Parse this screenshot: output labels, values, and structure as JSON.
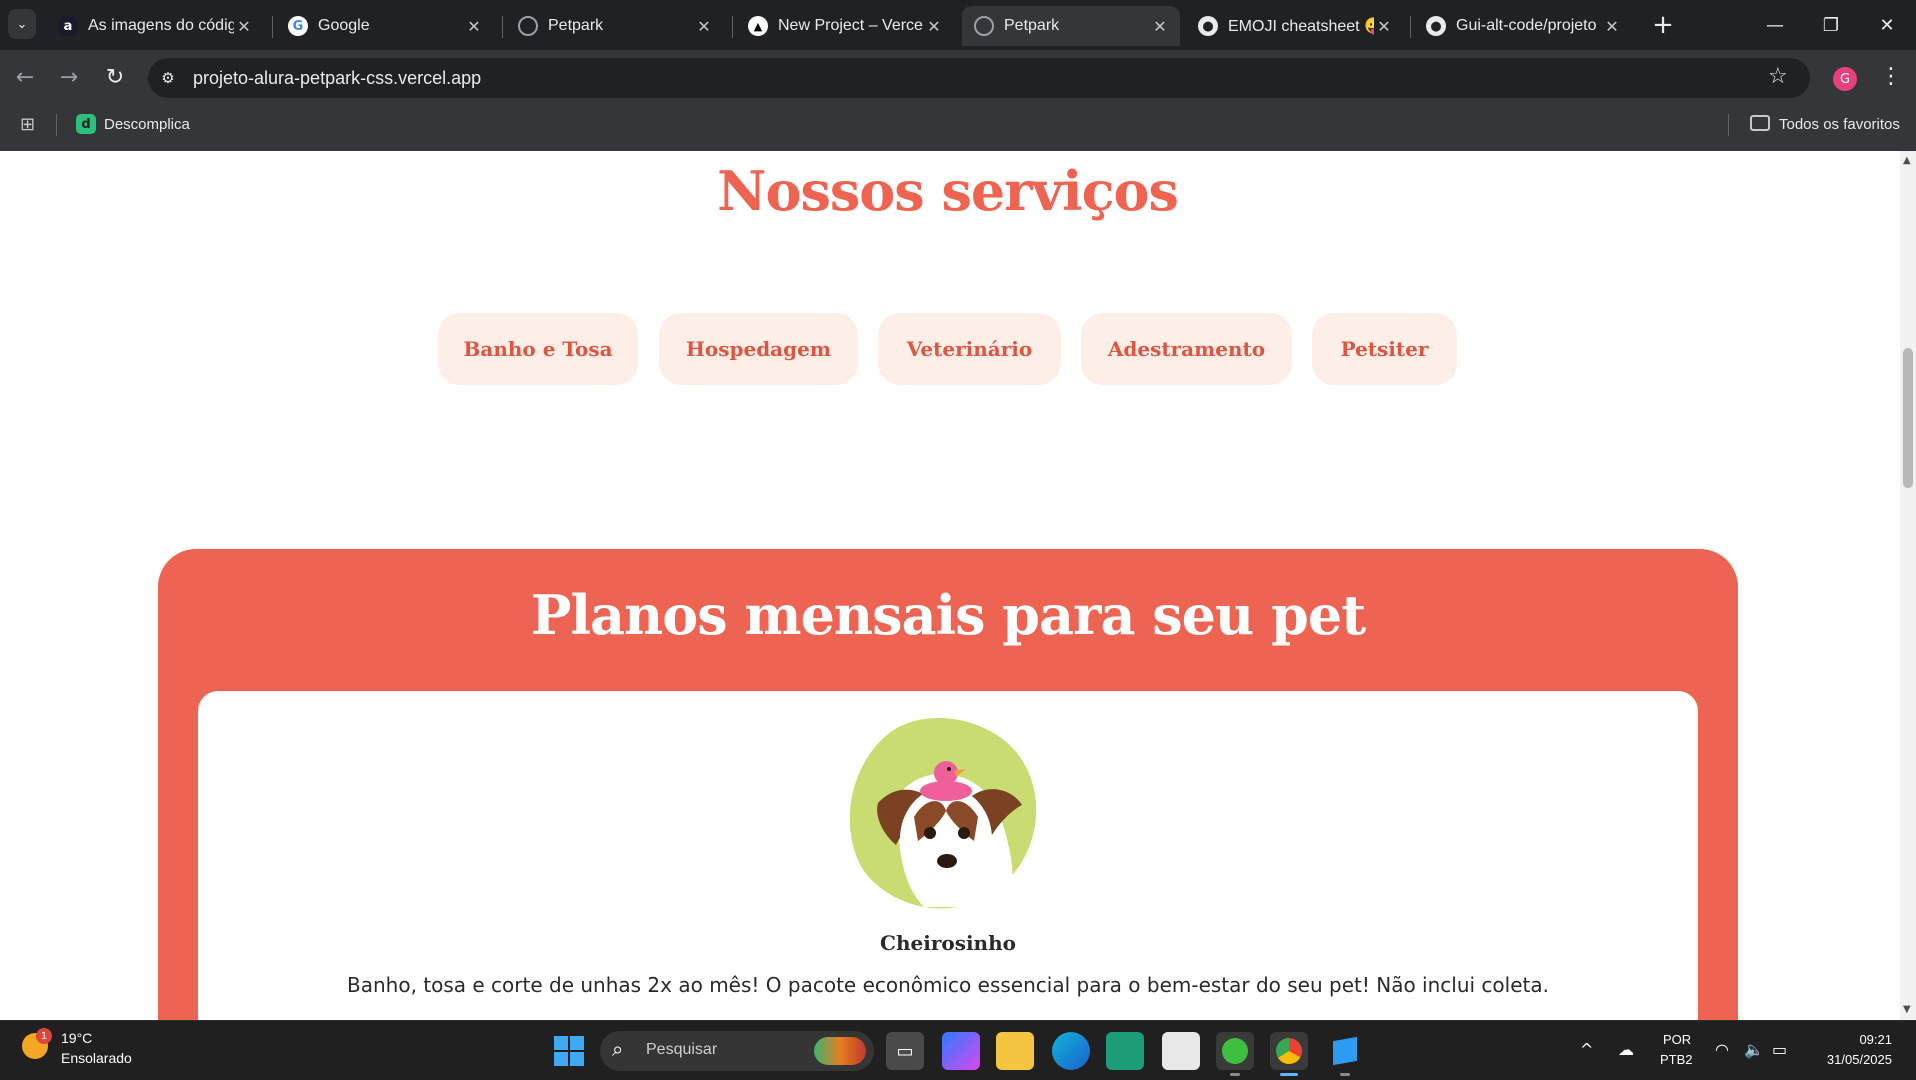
{
  "browser": {
    "tabs": [
      {
        "title": "As imagens do códig",
        "favicon": "a"
      },
      {
        "title": "Google",
        "favicon": "G"
      },
      {
        "title": "Petpark",
        "favicon": "globe"
      },
      {
        "title": "New Project – Vercel",
        "favicon": "▲"
      },
      {
        "title": "Petpark",
        "favicon": "globe",
        "active": true
      },
      {
        "title": "EMOJI cheatsheet 😛",
        "favicon": "github"
      },
      {
        "title": "Gui-alt-code/projeto",
        "favicon": "github"
      }
    ],
    "url": "projeto-alura-petpark-css.vercel.app",
    "profile_initial": "G",
    "bookmarks": {
      "items": [
        {
          "label": "Descomplica",
          "icon": "d"
        }
      ],
      "all_bookmarks_label": "Todos os favoritos"
    }
  },
  "page": {
    "services_title": "Nossos serviços",
    "services": [
      {
        "label": "Banho e Tosa"
      },
      {
        "label": "Hospedagem"
      },
      {
        "label": "Veterinário"
      },
      {
        "label": "Adestramento"
      },
      {
        "label": "Petsiter"
      }
    ],
    "plans_title": "Planos mensais para seu pet",
    "plan_card": {
      "name": "Cheirosinho",
      "description": "Banho, tosa e corte de unhas 2x ao mês! O pacote econômico essencial para o bem-estar do seu pet! Não inclui coleta.",
      "image": "dog-with-rubber-duck"
    },
    "colors": {
      "accent": "#ef6351",
      "button_bg": "#fdeee7",
      "blob": "#c8dc72"
    }
  },
  "taskbar": {
    "weather": {
      "temp": "19°C",
      "condition": "Ensolarado",
      "badge": "1"
    },
    "search_placeholder": "Pesquisar",
    "lang_line1": "POR",
    "lang_line2": "PTB2",
    "time": "09:21",
    "date": "31/05/2025"
  }
}
